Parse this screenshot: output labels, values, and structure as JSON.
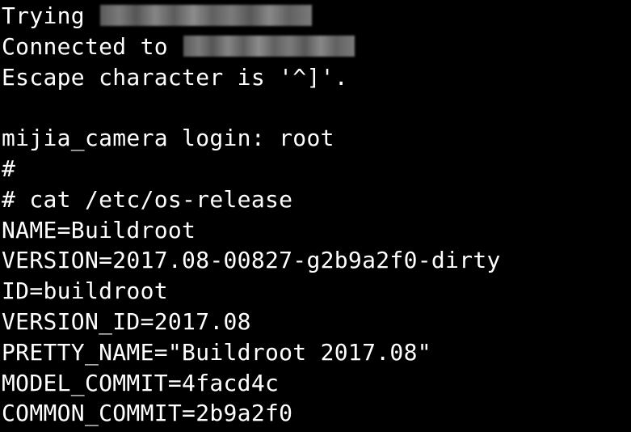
{
  "terminal": {
    "background": "#000000",
    "foreground": "#ffffff",
    "lines": {
      "trying": "Trying ",
      "connected": "Connected to ",
      "escape": "Escape character is '^]'.",
      "blank": "",
      "login": "mijia_camera login: root",
      "prompt_empty": "#",
      "cat_command": "# cat /etc/os-release",
      "name": "NAME=Buildroot",
      "version": "VERSION=2017.08-00827-g2b9a2f0-dirty",
      "id": "ID=buildroot",
      "version_id": "VERSION_ID=2017.08",
      "pretty_name": "PRETTY_NAME=\"Buildroot 2017.08\"",
      "model_commit": "MODEL_COMMIT=4facd4c",
      "common_commit": "COMMON_COMMIT=2b9a2f0"
    }
  }
}
